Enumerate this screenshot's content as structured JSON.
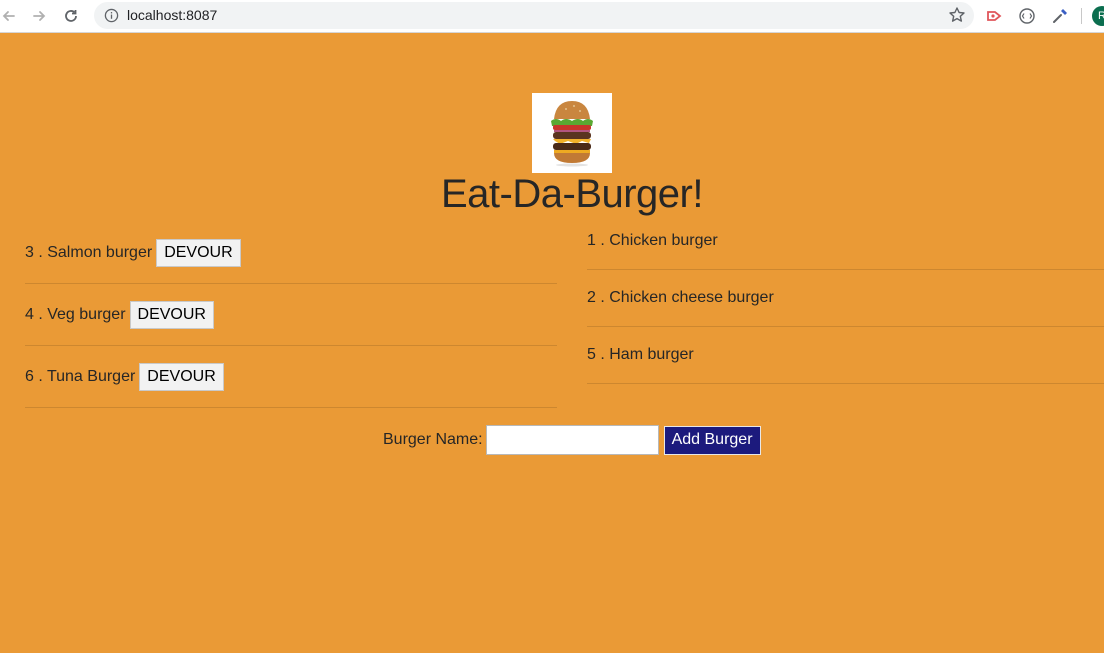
{
  "browser": {
    "url": "localhost:8087",
    "profile_initial": "R"
  },
  "page": {
    "title": "Eat-Da-Burger!",
    "logo_icon": "burger-image",
    "background_color": "#ea9a36"
  },
  "not_devoured": [
    {
      "label": "3 . Salmon burger",
      "button": "DEVOUR"
    },
    {
      "label": "4 . Veg burger",
      "button": "DEVOUR"
    },
    {
      "label": "6 . Tuna Burger",
      "button": "DEVOUR"
    }
  ],
  "devoured": [
    {
      "label": "1 . Chicken burger"
    },
    {
      "label": "2 . Chicken cheese burger"
    },
    {
      "label": "5 . Ham burger"
    }
  ],
  "form": {
    "label": "Burger Name:",
    "input_value": "",
    "submit_label": "Add Burger",
    "submit_color": "#1c1a7d"
  }
}
